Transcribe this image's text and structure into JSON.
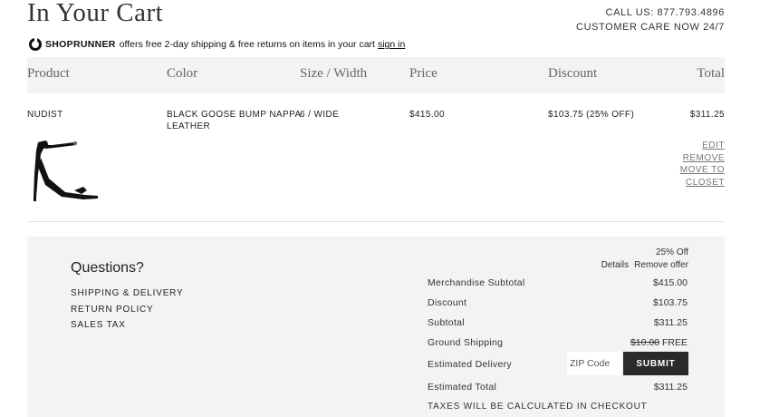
{
  "header": {
    "title": "In Your Cart",
    "call_us": "CALL US: 877.793.4896",
    "customer_care": "CUSTOMER CARE NOW 24/7"
  },
  "shoprunner": {
    "brand": "SHOPRUNNER",
    "text": "offers free 2-day shipping & free returns on items in your cart",
    "link": "sign in"
  },
  "table": {
    "headers": [
      "Product",
      "Color",
      "Size / Width",
      "Price",
      "Discount",
      "Total"
    ],
    "item": {
      "product": "NUDIST",
      "color_line1": "BLACK GOOSE BUMP NAPPA",
      "color_line2": "LEATHER",
      "size": "6 / WIDE",
      "price": "$415.00",
      "discount": "$103.75 (25% OFF)",
      "total": "$311.25",
      "actions": [
        "EDIT",
        "REMOVE",
        "MOVE TO",
        "CLOSET"
      ]
    }
  },
  "questions": {
    "title": "Questions?",
    "links": [
      "SHIPPING & DELIVERY",
      "RETURN POLICY",
      "SALES TAX"
    ]
  },
  "summary": {
    "offer": "25% Off",
    "details": "Details",
    "remove_offer": "Remove offer",
    "merch_label": "Merchandise Subtotal",
    "merch_value": "$415.00",
    "discount_label": "Discount",
    "discount_value": "$103.75",
    "subtotal_label": "Subtotal",
    "subtotal_value": "$311.25",
    "shipping_label": "Ground Shipping",
    "shipping_old": "$10.00",
    "shipping_new": "FREE",
    "delivery_label": "Estimated Delivery",
    "zip_placeholder": "ZIP Code",
    "submit": "SUBMIT",
    "total_label": "Estimated Total",
    "total_value": "$311.25",
    "tax_note": "TAXES WILL BE CALCULATED IN CHECKOUT"
  }
}
